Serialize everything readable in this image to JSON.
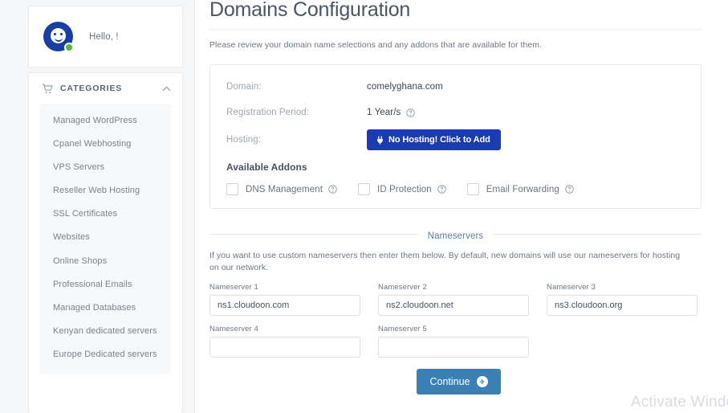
{
  "sidebar": {
    "profile": {
      "greeting": "Hello, !",
      "avatar_icon": "user-smiley-avatar-icon",
      "status_icon": "online-status-dot"
    },
    "categories": {
      "title": "CATEGORIES",
      "cart_icon": "shopping-cart-icon",
      "collapse_icon": "chevron-up-icon",
      "items": [
        {
          "label": "Managed WordPress"
        },
        {
          "label": "Cpanel Webhosting"
        },
        {
          "label": "VPS Servers"
        },
        {
          "label": "Reseller Web Hosting"
        },
        {
          "label": "SSL Certificates"
        },
        {
          "label": "Websites"
        },
        {
          "label": "Online Shops"
        },
        {
          "label": "Professional Emails"
        },
        {
          "label": "Managed Databases"
        },
        {
          "label": "Kenyan dedicated servers"
        },
        {
          "label": "Europe Dedicated servers"
        }
      ]
    }
  },
  "main": {
    "page_title": "Domains Configuration",
    "intro": "Please review your domain name selections and any addons that are available for them.",
    "domain_card": {
      "rows": [
        {
          "label": "Domain:",
          "value": "comelyghana.com"
        },
        {
          "label": "Registration Period:",
          "value": "1 Year/s",
          "info_icon": "help-circle-icon"
        },
        {
          "label": "Hosting:"
        }
      ],
      "hosting_button": {
        "label": "No Hosting! Click to Add",
        "icon": "plug-icon",
        "color": "#1a3cb0"
      },
      "addons_title": "Available Addons",
      "addons": [
        {
          "label": "DNS Management",
          "checked": false,
          "info_icon": "help-circle-icon"
        },
        {
          "label": "ID Protection",
          "checked": false,
          "info_icon": "help-circle-icon"
        },
        {
          "label": "Email Forwarding",
          "checked": false,
          "info_icon": "help-circle-icon"
        }
      ]
    },
    "nameservers": {
      "legend": "Nameservers",
      "description": "If you want to use custom nameservers then enter them below. By default, new domains will use our nameservers for hosting on our network.",
      "fields": [
        {
          "label": "Nameserver 1",
          "value": "ns1.cloudoon.com"
        },
        {
          "label": "Nameserver 2",
          "value": "ns2.cloudoon.net"
        },
        {
          "label": "Nameserver 3",
          "value": "ns3.cloudoon.org"
        },
        {
          "label": "Nameserver 4",
          "value": ""
        },
        {
          "label": "Nameserver 5",
          "value": ""
        }
      ]
    },
    "continue_button": {
      "label": "Continue",
      "icon": "arrow-right-circle-icon",
      "color": "#3a80b5"
    }
  },
  "watermark": {
    "text": "Activate Windows"
  }
}
